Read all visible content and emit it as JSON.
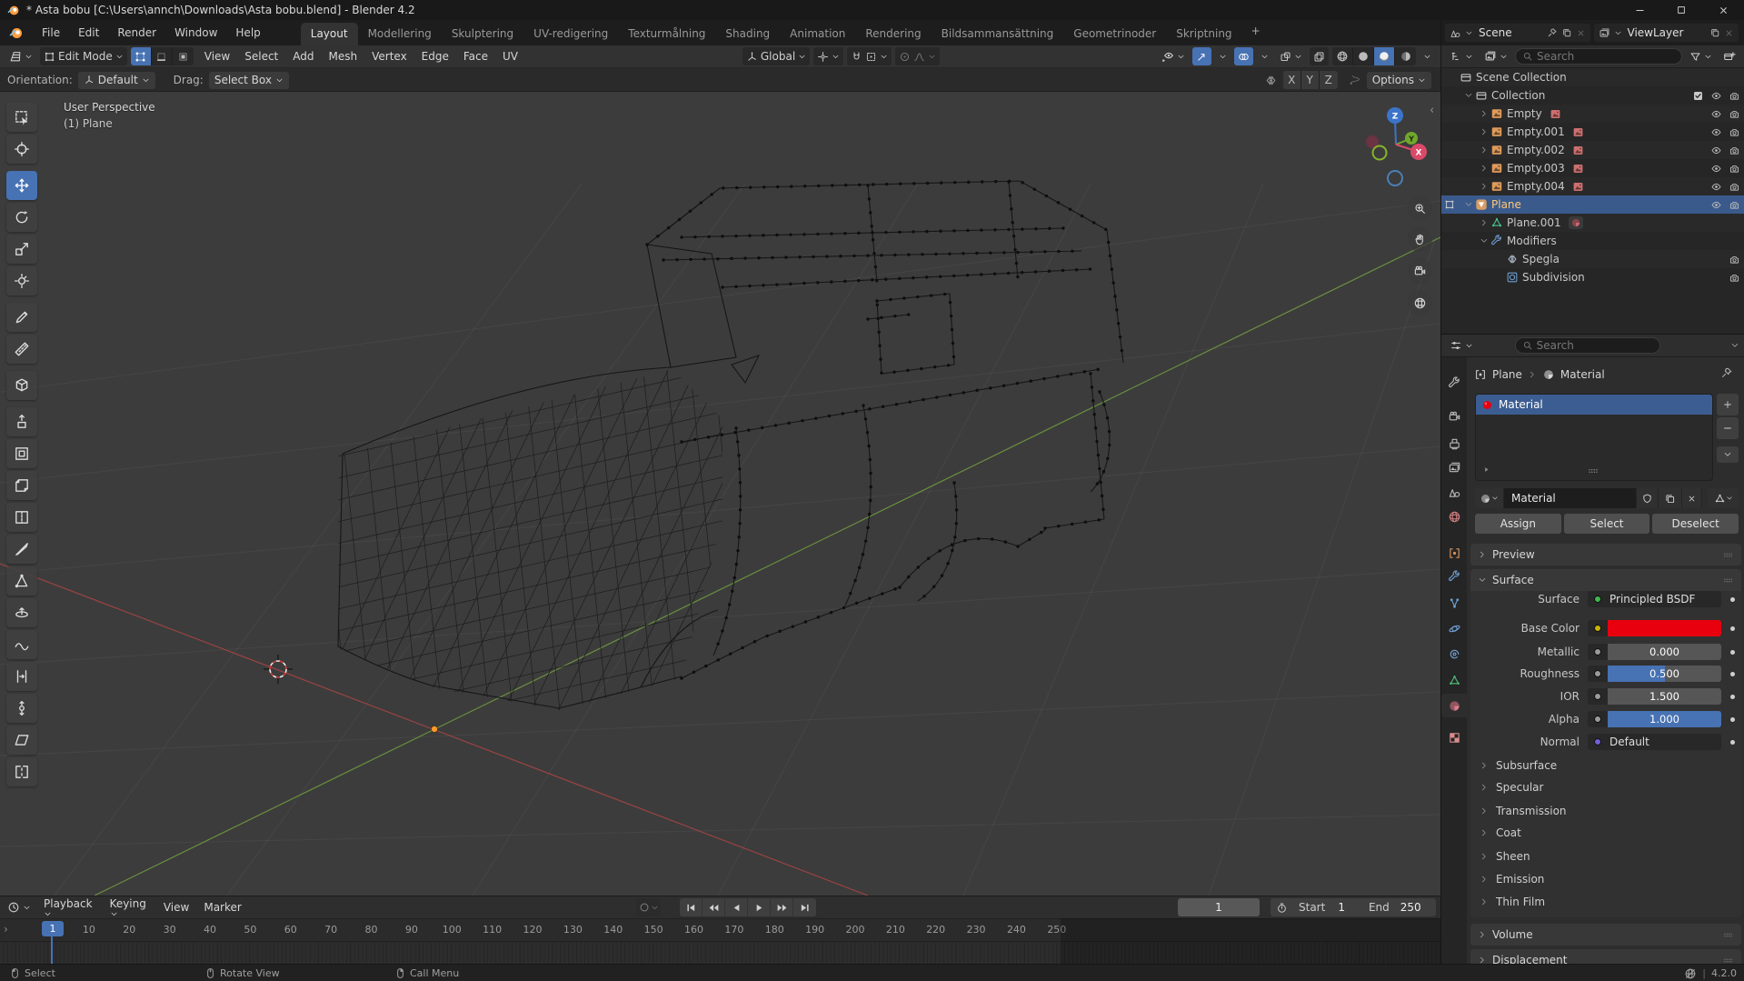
{
  "title_bar": {
    "title": "* Asta bobu [C:\\Users\\annch\\Downloads\\Asta bobu.blend] - Blender 4.2"
  },
  "menubar": {
    "menus": [
      "File",
      "Edit",
      "Render",
      "Window",
      "Help"
    ],
    "tabs": [
      "Layout",
      "Modellering",
      "Skulptering",
      "UV-redigering",
      "Texturmålning",
      "Shading",
      "Animation",
      "Rendering",
      "Bildsammansättning",
      "Geometrinoder",
      "Skriptning"
    ],
    "active_tab": "Layout",
    "add_tab": "+"
  },
  "scene_bar": {
    "scene": "Scene",
    "view_layer": "ViewLayer"
  },
  "viewport_header": {
    "mode": "Edit Mode",
    "menus": [
      "View",
      "Select",
      "Add",
      "Mesh",
      "Vertex",
      "Edge",
      "Face",
      "UV"
    ],
    "orientation": "Global"
  },
  "tool_settings": {
    "orientation_label": "Orientation:",
    "orientation_value": "Default",
    "drag_label": "Drag:",
    "drag_value": "Select Box",
    "axes": [
      "X",
      "Y",
      "Z"
    ],
    "options": "Options"
  },
  "viewport": {
    "view_label": "User Perspective",
    "object_label": "(1) Plane",
    "gizmo": {
      "x": "X",
      "y": "Y",
      "z": "Z"
    }
  },
  "toolbar": {
    "active_index": 2,
    "tools": [
      "select-box",
      "cursor",
      "move",
      "rotate",
      "scale",
      "transform",
      "annotate",
      "measure",
      "add-cube",
      "extrude-region",
      "inset-faces",
      "bevel",
      "loop-cut",
      "knife",
      "poly-build",
      "spin",
      "smooth",
      "edge-slide",
      "shrink-fatten",
      "shear",
      "rip-region"
    ]
  },
  "outliner": {
    "search_placeholder": "Search",
    "rows": [
      {
        "label": "Scene Collection",
        "icon": "collection",
        "indent": 0,
        "expander": null,
        "badge": null,
        "right": []
      },
      {
        "label": "Collection",
        "icon": "collection",
        "indent": 1,
        "expander": "down",
        "badge": null,
        "right": [
          "check",
          "eye",
          "camera"
        ]
      },
      {
        "label": "Empty",
        "icon": "empty",
        "indent": 2,
        "expander": "right",
        "badge": "image",
        "right": [
          "eye",
          "camera"
        ]
      },
      {
        "label": "Empty.001",
        "icon": "empty",
        "indent": 2,
        "expander": "right",
        "badge": "image",
        "right": [
          "eye",
          "camera"
        ]
      },
      {
        "label": "Empty.002",
        "icon": "empty",
        "indent": 2,
        "expander": "right",
        "badge": "image",
        "right": [
          "eye",
          "camera"
        ]
      },
      {
        "label": "Empty.003",
        "icon": "empty",
        "indent": 2,
        "expander": "right",
        "badge": "image",
        "right": [
          "eye",
          "camera"
        ]
      },
      {
        "label": "Empty.004",
        "icon": "empty",
        "indent": 2,
        "expander": "right",
        "badge": "image",
        "right": [
          "eye",
          "camera"
        ]
      },
      {
        "label": "Plane",
        "icon": "plane",
        "indent": 1,
        "expander": "down",
        "badge": null,
        "right": [
          "eye",
          "camera"
        ],
        "selected": true,
        "leading": "editmode"
      },
      {
        "label": "Plane.001",
        "icon": "meshdata",
        "indent": 2,
        "expander": "right",
        "badge": "material",
        "right": []
      },
      {
        "label": "Modifiers",
        "icon": "wrench",
        "indent": 2,
        "expander": "down",
        "badge": null,
        "right": []
      },
      {
        "label": "Spegla",
        "icon": "mirror",
        "indent": 3,
        "expander": null,
        "badge": null,
        "right": [
          "camera"
        ]
      },
      {
        "label": "Subdivision",
        "icon": "subdiv",
        "indent": 3,
        "expander": null,
        "badge": null,
        "right": [
          "camera"
        ]
      }
    ]
  },
  "properties": {
    "search_placeholder": "Search",
    "breadcrumb": {
      "object": "Plane",
      "datablock": "Material"
    },
    "slot_name": "Material",
    "datablock_name": "Material",
    "actions": {
      "assign": "Assign",
      "select": "Select",
      "deselect": "Deselect"
    },
    "panels": {
      "preview": "Preview",
      "surface": "Surface",
      "volume": "Volume",
      "displacement": "Displacement"
    },
    "tabs": [
      "tool",
      "render",
      "output",
      "view-layer",
      "scene",
      "world",
      "object",
      "modifiers",
      "particles",
      "physics",
      "constraints",
      "object-data",
      "material",
      "texture"
    ],
    "active_tab": "material",
    "surface_rows": [
      {
        "label": "Surface",
        "value": "Principled BSDF",
        "widget": "dropdown",
        "socket": "#3fb950"
      },
      {
        "label": "Base Color",
        "value": "",
        "widget": "color",
        "socket": "#c8b400",
        "color": "#e8000e"
      },
      {
        "label": "Metallic",
        "value": "0.000",
        "widget": "slider",
        "socket": "#9a9a9a",
        "fill": 0
      },
      {
        "label": "Roughness",
        "value": "0.500",
        "widget": "slider",
        "socket": "#9a9a9a",
        "fill": 0.5
      },
      {
        "label": "IOR",
        "value": "1.500",
        "widget": "slider",
        "socket": "#9a9a9a",
        "fill": 0
      },
      {
        "label": "Alpha",
        "value": "1.000",
        "widget": "slider",
        "socket": "#9a9a9a",
        "fill": 1
      },
      {
        "label": "Normal",
        "value": "Default",
        "widget": "dropdown",
        "socket": "#7060d8"
      }
    ],
    "collapsed_sections": [
      "Subsurface",
      "Specular",
      "Transmission",
      "Coat",
      "Sheen",
      "Emission",
      "Thin Film"
    ]
  },
  "timeline": {
    "menus": [
      "Playback",
      "Keying",
      "View",
      "Marker"
    ],
    "current_frame": "1",
    "start_label": "Start",
    "start": "1",
    "end_label": "End",
    "end": "250",
    "ticks": [
      10,
      20,
      30,
      40,
      50,
      60,
      70,
      80,
      90,
      100,
      110,
      120,
      130,
      140,
      150,
      160,
      170,
      180,
      190,
      200,
      210,
      220,
      230,
      240,
      250
    ]
  },
  "status_bar": {
    "hints": [
      {
        "button": "left-mouse",
        "label": "Select"
      },
      {
        "button": "middle-mouse",
        "label": "Rotate View"
      },
      {
        "button": "right-mouse",
        "label": "Call Menu"
      }
    ],
    "version": "4.2.0"
  },
  "colors": {
    "accent": "#4772b3",
    "base_color": "#e8000e",
    "active_object_text": "#ffc878",
    "selection_row": "#3a5a8c"
  }
}
